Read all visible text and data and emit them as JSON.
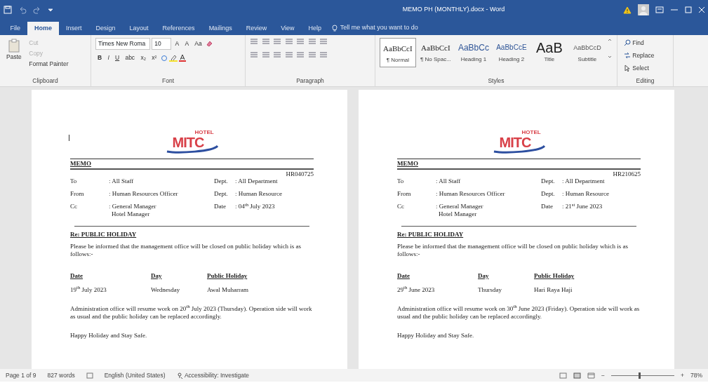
{
  "window": {
    "title": "MEMO PH (MONTHLY).docx - Word"
  },
  "tabs": [
    {
      "label": "File",
      "selected": false
    },
    {
      "label": "Home",
      "selected": true
    },
    {
      "label": "Insert",
      "selected": false
    },
    {
      "label": "Design",
      "selected": false
    },
    {
      "label": "Layout",
      "selected": false
    },
    {
      "label": "References",
      "selected": false
    },
    {
      "label": "Mailings",
      "selected": false
    },
    {
      "label": "Review",
      "selected": false
    },
    {
      "label": "View",
      "selected": false
    },
    {
      "label": "Help",
      "selected": false
    }
  ],
  "tell_me": {
    "placeholder": "Tell me what you want to do"
  },
  "clipboard": {
    "label": "Clipboard",
    "paste": "Paste",
    "actions": [
      {
        "label": "Cut",
        "disabled": true
      },
      {
        "label": "Copy",
        "disabled": true
      },
      {
        "label": "Format Painter",
        "disabled": false
      }
    ]
  },
  "font": {
    "label": "Font",
    "font_name": "Times New Roma",
    "font_size": "10",
    "grow_buttons": [
      "A",
      "A",
      "Aa"
    ],
    "format_buttons": [
      "B",
      "I",
      "U",
      "abc",
      "x₂",
      "x²"
    ]
  },
  "paragraph": {
    "label": "Paragraph"
  },
  "styles": {
    "label": "Styles",
    "items": [
      {
        "kind": "normal",
        "sample": "AaBbCcI",
        "label": "¶ Normal",
        "selected": true
      },
      {
        "kind": "normal",
        "sample": "AaBbCcI",
        "label": "¶ No Spac...",
        "selected": false
      },
      {
        "kind": "heading1",
        "sample": "AaBbCc",
        "label": "Heading 1",
        "selected": false
      },
      {
        "kind": "heading2",
        "sample": "AaBbCcE",
        "label": "Heading 2",
        "selected": false
      },
      {
        "kind": "title",
        "sample": "AaB",
        "label": "Title",
        "selected": false
      },
      {
        "kind": "subtitle",
        "sample": "AaBbCcD",
        "label": "Subtitle",
        "selected": false
      }
    ]
  },
  "editing": {
    "label": "Editing",
    "actions": [
      "Find",
      "Replace",
      "Select"
    ]
  },
  "pages": [
    {
      "cursor": true,
      "logo": {
        "small": "HOTEL",
        "big": "MITC"
      },
      "heading": "MEMO",
      "reference": "HR040725",
      "rows": [
        {
          "label": "To",
          "value": ": All Staff",
          "label2": "Dept.",
          "value2": ": All Department"
        },
        {
          "label": "From",
          "value": ": Human Resources Officer",
          "label2": "Dept.",
          "value2": ": Human Resource"
        },
        {
          "label": "Cc",
          "value": ": General Manager",
          "value_extra": "Hotel Manager",
          "label2": "Date",
          "value2": ": 04$^{th}$ July 2023"
        }
      ],
      "subject": "Re: PUBLIC HOLIDAY",
      "intro": "Please be informed that the management office will be closed on public holiday which is as follows:-",
      "columns": [
        "Date",
        "Day",
        "Public Holiday"
      ],
      "holiday": [
        "19$^{th}$ July 2023",
        "Wednesday",
        "Awal Muharram"
      ],
      "resume": "Administration office will resume work on 20$^{th}$ July 2023 (Thursday). Operation side will work as usual and the public holiday can be replaced accordingly.",
      "closing": "Happy Holiday and Stay Safe."
    },
    {
      "cursor": false,
      "logo": {
        "small": "HOTEL",
        "big": "MITC"
      },
      "heading": "MEMO",
      "reference": "HR210625",
      "rows": [
        {
          "label": "To",
          "value": ": All Staff",
          "label2": "Dept.",
          "value2": ": All Department"
        },
        {
          "label": "From",
          "value": ": Human Resources Officer",
          "label2": "Dept.",
          "value2": ": Human Resource"
        },
        {
          "label": "Cc",
          "value": ": General Manager",
          "value_extra": "Hotel Manager",
          "label2": "Date",
          "value2": ": 21$^{st}$ June 2023"
        }
      ],
      "subject": "Re: PUBLIC HOLIDAY",
      "intro": "Please be informed that the management office will be closed on public holiday which is as follows:-",
      "columns": [
        "Date",
        "Day",
        "Public Holiday"
      ],
      "holiday": [
        "29$^{th}$ June 2023",
        "Thursday",
        "Hari Raya Haji"
      ],
      "resume": "Administration office will resume work on 30$^{th}$ June 2023 (Friday). Operation side will work as usual and the public holiday can be replaced accordingly.",
      "closing": "Happy Holiday and Stay Safe."
    }
  ],
  "status_bar": {
    "page": "Page 1 of 9",
    "words": "827 words",
    "language": "English (United States)",
    "accessibility": "Accessibility: Investigate",
    "zoom_out": "−",
    "zoom_in": "+",
    "zoom": "78%",
    "level": 0.45
  }
}
